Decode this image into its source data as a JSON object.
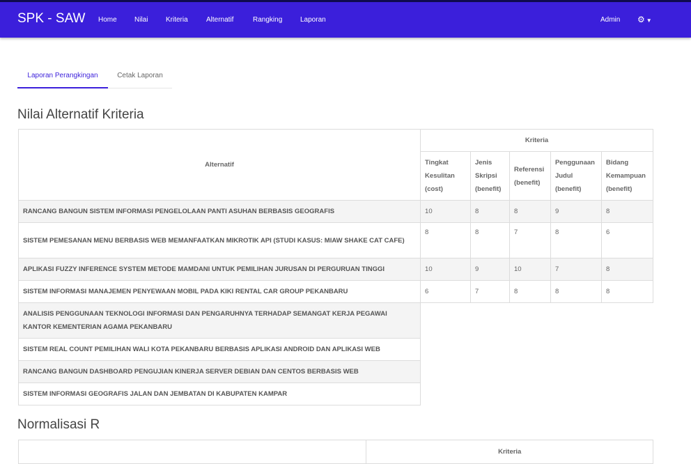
{
  "navbar": {
    "brand": "SPK - SAW",
    "links": [
      "Home",
      "Nilai",
      "Kriteria",
      "Alternatif",
      "Rangking",
      "Laporan"
    ],
    "user": "Admin"
  },
  "tabs": [
    "Laporan Perangkingan",
    "Cetak Laporan"
  ],
  "section1": {
    "title": "Nilai Alternatif Kriteria",
    "col_alternatif": "Alternatif",
    "col_group": "Kriteria",
    "criteria": [
      [
        "Tingkat",
        "Kesulitan",
        "(cost)"
      ],
      [
        "Jenis",
        "Skripsi",
        "(benefit)"
      ],
      [
        "Referensi",
        "(benefit)"
      ],
      [
        "Penggunaan",
        "Judul",
        "(benefit)"
      ],
      [
        "Bidang",
        "Kemampuan",
        "(benefit)"
      ]
    ],
    "rows": [
      {
        "name": "RANCANG BANGUN SISTEM INFORMASI PENGELOLAAN PANTI ASUHAN BERBASIS GEOGRAFIS",
        "values": [
          "10",
          "8",
          "8",
          "9",
          "8"
        ]
      },
      {
        "name": "SISTEM PEMESANAN MENU BERBASIS WEB MEMANFAATKAN MIKROTIK API (STUDI KASUS: MIAW SHAKE CAT CAFE)",
        "values": [
          "8",
          "8",
          "7",
          "8",
          "6"
        ]
      },
      {
        "name": "APLIKASI FUZZY INFERENCE SYSTEM METODE MAMDANI UNTUK PEMILIHAN JURUSAN DI PERGURUAN TINGGI",
        "values": [
          "10",
          "9",
          "10",
          "7",
          "8"
        ]
      },
      {
        "name": "SISTEM INFORMASI MANAJEMEN PENYEWAAN MOBIL PADA KIKI RENTAL CAR GROUP PEKANBARU",
        "values": [
          "6",
          "7",
          "8",
          "8",
          "8"
        ]
      },
      {
        "name": "ANALISIS PENGGUNAAN TEKNOLOGI INFORMASI DAN PENGARUHNYA TERHADAP SEMANGAT KERJA PEGAWAI KANTOR KEMENTERIAN AGAMA PEKANBARU",
        "values": []
      },
      {
        "name": "SISTEM REAL COUNT PEMILIHAN WALI KOTA PEKANBARU BERBASIS APLIKASI ANDROID DAN APLIKASI WEB",
        "values": []
      },
      {
        "name": "RANCANG BANGUN DASHBOARD PENGUJIAN KINERJA SERVER DEBIAN DAN CENTOS BERBASIS WEB",
        "values": []
      },
      {
        "name": "SISTEM INFORMASI GEOGRAFIS JALAN DAN JEMBATAN DI KABUPATEN KAMPAR",
        "values": []
      }
    ]
  },
  "section2": {
    "title": "Normalisasi R",
    "col_group": "Kriteria"
  }
}
